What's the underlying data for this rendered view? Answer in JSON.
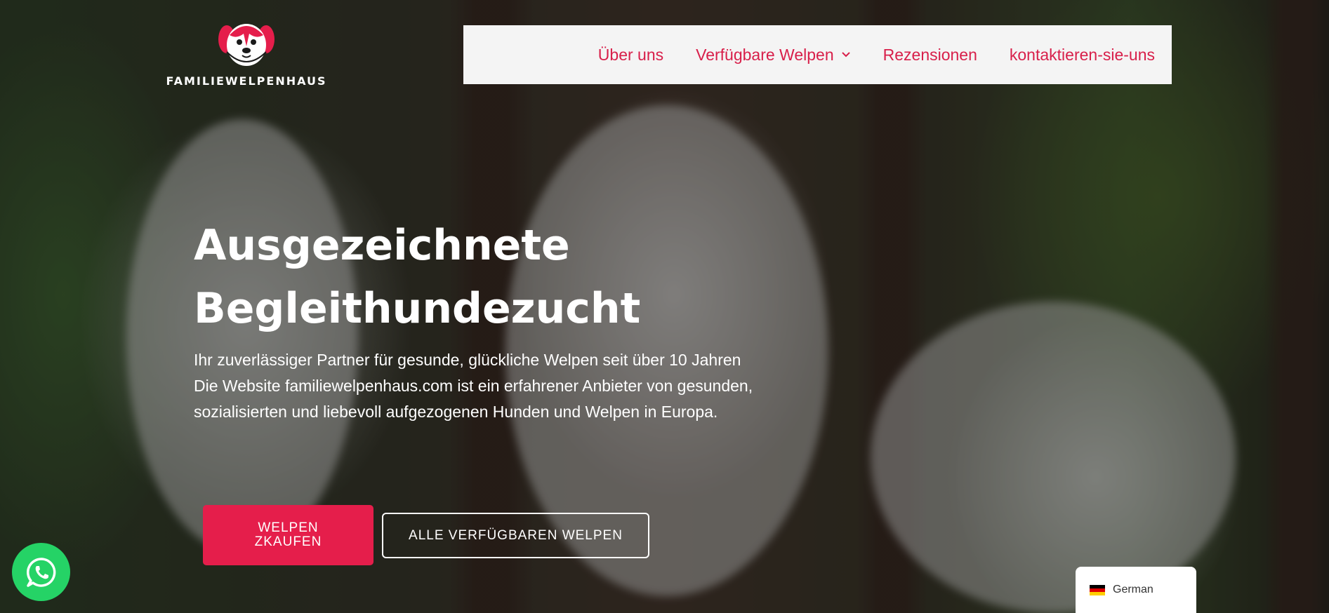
{
  "brand": {
    "name": "FAMILIEWELPENHAUS",
    "accent": "#e51e4b",
    "nav_text_color": "#d81f4a"
  },
  "nav": {
    "items": [
      {
        "label": "Über uns"
      },
      {
        "label": "Verfügbare Welpen",
        "has_dropdown": true
      },
      {
        "label": "Rezensionen"
      },
      {
        "label": "kontaktieren-sie-uns"
      }
    ]
  },
  "hero": {
    "title_line1": "Ausgezeichnete",
    "title_line2": "Begleithundezucht",
    "description": "Ihr zuverlässiger Partner für gesunde, glückliche Welpen seit über 10 Jahren Die Website familiewelpenhaus.com ist ein erfahrener Anbieter von gesunden, sozialisierten und liebevoll aufgezogenen Hunden und Welpen in Europa.",
    "buttons": {
      "primary": "WELPEN ZKAUFEN",
      "secondary": "ALLE VERFÜGBAREN WELPEN"
    }
  },
  "widgets": {
    "whatsapp_icon": "whatsapp-icon",
    "whatsapp_color": "#25d366",
    "language": "German",
    "language_flag": "germany-flag-icon"
  }
}
